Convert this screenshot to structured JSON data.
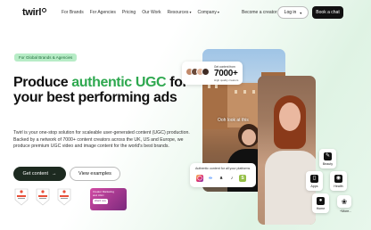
{
  "brand": {
    "logo_text": "twirl"
  },
  "nav": {
    "links": [
      {
        "label": "For Brands"
      },
      {
        "label": "For Agencies"
      },
      {
        "label": "Pricing"
      },
      {
        "label": "Our Work"
      },
      {
        "label": "Resources"
      },
      {
        "label": "Company"
      }
    ],
    "creator_link": "Become a creator",
    "login_label": "Log in",
    "cta_label": "Book a chat"
  },
  "hero": {
    "tag": "For Global Brands & Agencies",
    "headline_part1": "Produce ",
    "headline_accent": "authentic UGC",
    "headline_part2": "for your best performing ads",
    "description": "Twirl is your one-stop solution for scaleable user-generated content (UGC) production. Backed by a network of 7000+ content creators across the UK, US and Europe, we produce premium UGC video and image content for the world's best brands.",
    "primary_cta": "Get content",
    "secondary_cta": "View examples"
  },
  "badges": [
    {
      "name": "G2 badge 1"
    },
    {
      "name": "G2 badge 2"
    },
    {
      "name": "G2 badge 3"
    }
  ],
  "promo": {
    "line1": "Creator Marketing",
    "line2": "and UGC",
    "button": "Watch now"
  },
  "visual": {
    "caption": "Ooh look at this",
    "creators_card": {
      "label": "Get content from",
      "number": "7000+",
      "sub": "High quality creators"
    },
    "platforms_card": {
      "title": "Authentic content for all your platforms"
    },
    "categories": [
      {
        "label": "Beauty"
      },
      {
        "label": "Apps"
      },
      {
        "label": "Health"
      },
      {
        "label": "Home"
      }
    ],
    "more_label": "+More..."
  },
  "colors": {
    "accent": "#2ea84f",
    "dark": "#111111",
    "tag_bg": "#b7ecc6"
  }
}
